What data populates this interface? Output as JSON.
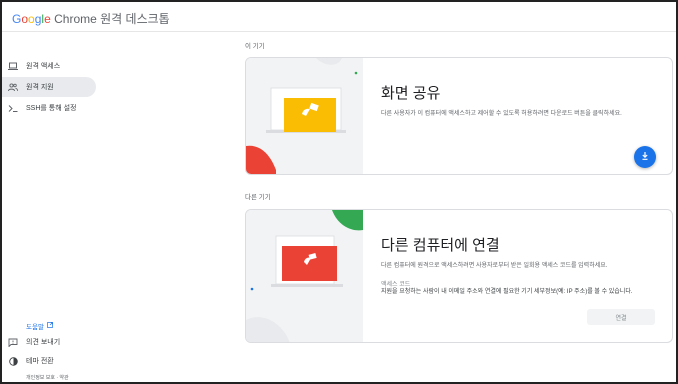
{
  "header": {
    "logo_google": "Google",
    "logo_rest": "Chrome 원격 데스크톱"
  },
  "sidebar": {
    "items": [
      {
        "label": "원격 액세스",
        "icon": "laptop-icon"
      },
      {
        "label": "원격 지원",
        "icon": "people-icon",
        "active": true
      },
      {
        "label": "SSH를 통해 설정",
        "icon": "terminal-icon"
      }
    ],
    "help_label": "도움말",
    "feedback_label": "의견 보내기",
    "theme_label": "테마 전환",
    "footer_text": "개인정보 보호 · 약관"
  },
  "main": {
    "this_device_label": "이 기기",
    "share": {
      "title": "화면 공유",
      "description": "다른 사용자가 이 컴퓨터에 액세스하고 제어할 수 있도록 허용하려면 다운로드 버튼을 클릭하세요."
    },
    "other_device_label": "다른 기기",
    "connect": {
      "title": "다른 컴퓨터에 연결",
      "description": "다른 컴퓨터에 원격으로 액세스하려면 사용자로부터 받은 일회용 액세스 코드를 입력하세요.",
      "field_label": "액세스 코드",
      "field_hint": "지원을 요청하는 사람이 내 이메일 주소와 연결에 필요한 기기 세부정보(예: IP 주소)를 볼 수 있습니다.",
      "button_label": "연결"
    }
  },
  "colors": {
    "accent_blue": "#1a73e8",
    "illus_yellow": "#fbbc04",
    "illus_red": "#ea4335",
    "illus_green": "#34a853"
  }
}
